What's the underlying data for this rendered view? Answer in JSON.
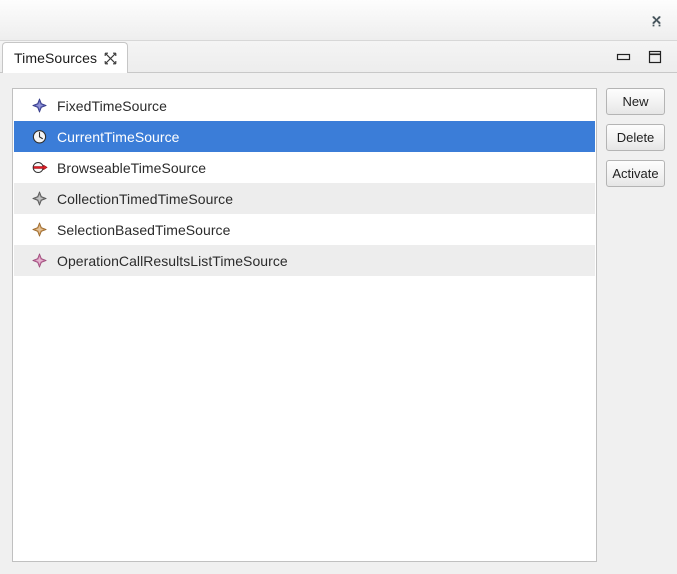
{
  "window": {
    "close_icon": "close-icon",
    "background": "#f0f0f0"
  },
  "tabs": [
    {
      "label": "TimeSources",
      "close_icon": "tab-close-icon",
      "active": true
    }
  ],
  "view_buttons": [
    {
      "name": "minimize",
      "icon": "minimize-icon"
    },
    {
      "name": "maximize",
      "icon": "maximize-icon"
    }
  ],
  "list": {
    "selection_color": "#3b7dd8",
    "alt_row_color": "#ededed",
    "items": [
      {
        "label": "FixedTimeSource",
        "icon": "diamond-icon",
        "icon_color": "#4a4fa8",
        "selected": false,
        "alt": false
      },
      {
        "label": "CurrentTimeSource",
        "icon": "clock-icon",
        "icon_color": "#f2f2f2",
        "selected": true,
        "alt": false
      },
      {
        "label": "BrowseableTimeSource",
        "icon": "interface-arrow-icon",
        "icon_color": "#e01b24",
        "selected": false,
        "alt": false
      },
      {
        "label": "CollectionTimedTimeSource",
        "icon": "diamond-icon",
        "icon_color": "#6f6f6f",
        "selected": false,
        "alt": true
      },
      {
        "label": "SelectionBasedTimeSource",
        "icon": "diamond-icon",
        "icon_color": "#c08c4a",
        "selected": false,
        "alt": false
      },
      {
        "label": "OperationCallResultsListTimeSource",
        "icon": "diamond-icon",
        "icon_color": "#c06a9c",
        "selected": false,
        "alt": true
      }
    ]
  },
  "buttons": [
    {
      "label": "New",
      "name": "new-button"
    },
    {
      "label": "Delete",
      "name": "delete-button"
    },
    {
      "label": "Activate",
      "name": "activate-button"
    }
  ]
}
